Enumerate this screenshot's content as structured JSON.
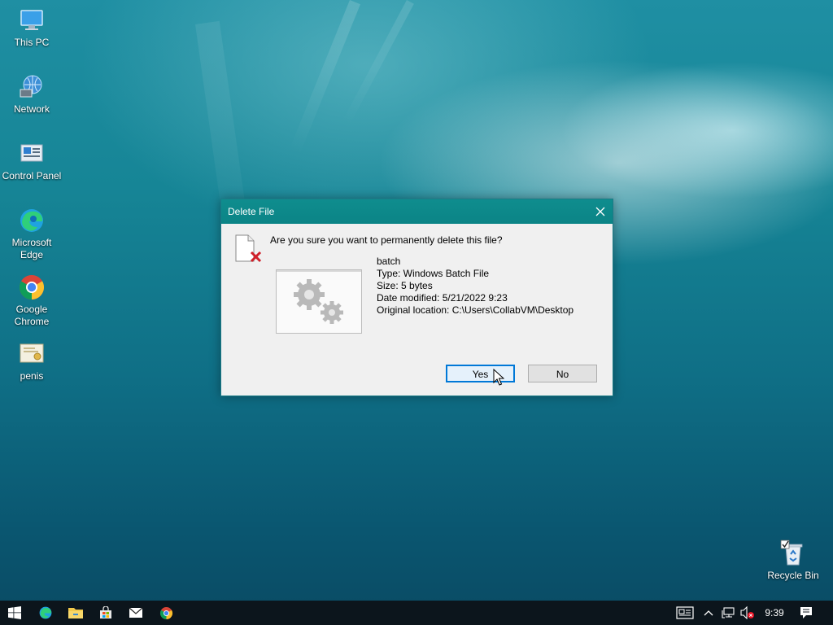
{
  "desktop": {
    "icons": [
      {
        "label": "This PC",
        "icon": "this-pc-icon"
      },
      {
        "label": "Network",
        "icon": "network-icon"
      },
      {
        "label": "Control Panel",
        "icon": "control-panel-icon"
      },
      {
        "label": "Microsoft Edge",
        "icon": "edge-icon"
      },
      {
        "label": "Google Chrome",
        "icon": "chrome-icon"
      },
      {
        "label": "penis",
        "icon": "certificate-file-icon"
      },
      {
        "label": "Recycle Bin",
        "icon": "recycle-bin-icon"
      }
    ]
  },
  "dialog": {
    "title": "Delete File",
    "question": "Are you sure you want to permanently delete this file?",
    "file": {
      "name": "batch",
      "type": "Type: Windows Batch File",
      "size": "Size: 5 bytes",
      "modified": "Date modified: 5/21/2022 9:23",
      "location": "Original location: C:\\Users\\CollabVM\\Desktop"
    },
    "yes_label": "Yes",
    "no_label": "No"
  },
  "taskbar": {
    "pinned": [
      "start-icon",
      "edge-icon",
      "file-explorer-icon",
      "store-icon",
      "mail-icon",
      "chrome-icon"
    ],
    "clock": "9:39"
  },
  "colors": {
    "titlebar": "#0b8486",
    "accent": "#0078d7"
  }
}
